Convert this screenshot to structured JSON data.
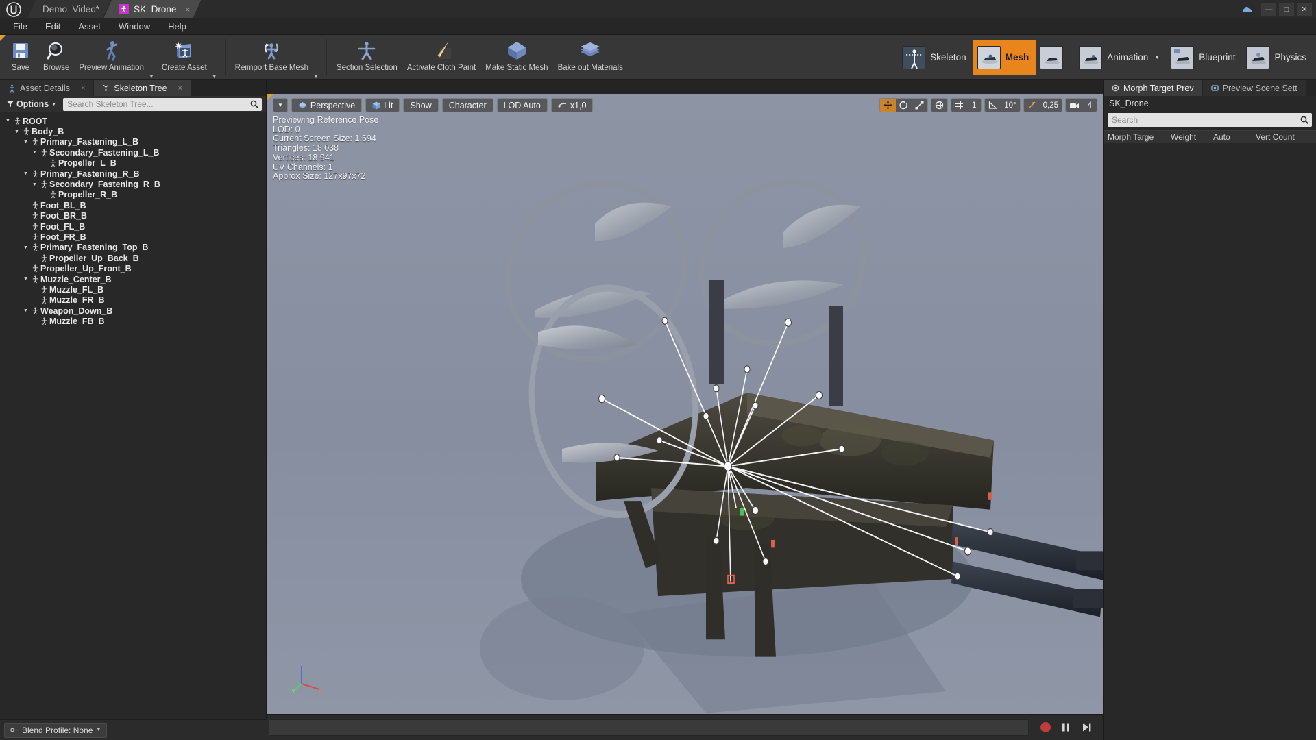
{
  "window": {
    "app": "Unreal Engine",
    "logo_glyph": "Ⓤ",
    "tabs": [
      {
        "label": "Demo_Video*",
        "icon": "",
        "active": false,
        "close": "×"
      },
      {
        "label": "SK_Drone",
        "icon": "person-icon",
        "active": true,
        "close": "×"
      }
    ],
    "controls": {
      "cloud": "☁",
      "minimize": "—",
      "maximize": "□",
      "close": "✕"
    }
  },
  "menubar": {
    "items": [
      "File",
      "Edit",
      "Asset",
      "Window",
      "Help"
    ]
  },
  "toolbar": {
    "groups": [
      {
        "buttons": [
          {
            "label": "Save",
            "icon": "save-icon",
            "caret": false
          },
          {
            "label": "Browse",
            "icon": "browse-icon",
            "caret": false
          },
          {
            "label": "Preview Animation",
            "icon": "preview-animation-icon",
            "caret": true
          },
          {
            "label": "Create Asset",
            "icon": "create-asset-icon",
            "caret": true
          }
        ]
      },
      {
        "buttons": [
          {
            "label": "Reimport Base Mesh",
            "icon": "reimport-icon",
            "caret": true
          }
        ]
      },
      {
        "buttons": [
          {
            "label": "Section Selection",
            "icon": "section-selection-icon",
            "caret": false
          },
          {
            "label": "Activate Cloth Paint",
            "icon": "cloth-paint-icon",
            "caret": false
          },
          {
            "label": "Make Static Mesh",
            "icon": "make-static-mesh-icon",
            "caret": false
          },
          {
            "label": "Bake out Materials",
            "icon": "bake-materials-icon",
            "caret": false
          }
        ]
      }
    ],
    "modes": [
      {
        "label": "Skeleton",
        "active": false,
        "caret": false,
        "icon": "skeleton-thumb"
      },
      {
        "label": "Mesh",
        "active": true,
        "caret": false,
        "icon": "mesh-thumb"
      },
      {
        "label": "",
        "active": false,
        "caret": false,
        "icon": "anim-thumb-small"
      },
      {
        "label": "Animation",
        "active": false,
        "caret": true,
        "icon": "animation-thumb"
      },
      {
        "label": "Blueprint",
        "active": false,
        "caret": false,
        "icon": "blueprint-thumb"
      },
      {
        "label": "Physics",
        "active": false,
        "caret": false,
        "icon": "physics-thumb"
      }
    ]
  },
  "left_panel": {
    "tabs": [
      {
        "label": "Asset Details",
        "active": false,
        "icon": "asset-details-icon",
        "close": "×"
      },
      {
        "label": "Skeleton Tree",
        "active": true,
        "icon": "skeleton-tree-icon",
        "close": "×"
      }
    ],
    "options_label": "Options",
    "search_placeholder": "Search Skeleton Tree...",
    "search_value": "",
    "tree": [
      {
        "label": "ROOT",
        "depth": 0,
        "expandable": true
      },
      {
        "label": "Body_B",
        "depth": 1,
        "expandable": true
      },
      {
        "label": "Primary_Fastening_L_B",
        "depth": 2,
        "expandable": true
      },
      {
        "label": "Secondary_Fastening_L_B",
        "depth": 3,
        "expandable": true
      },
      {
        "label": "Propeller_L_B",
        "depth": 4,
        "expandable": false
      },
      {
        "label": "Primary_Fastening_R_B",
        "depth": 2,
        "expandable": true
      },
      {
        "label": "Secondary_Fastening_R_B",
        "depth": 3,
        "expandable": true
      },
      {
        "label": "Propeller_R_B",
        "depth": 4,
        "expandable": false
      },
      {
        "label": "Foot_BL_B",
        "depth": 2,
        "expandable": false
      },
      {
        "label": "Foot_BR_B",
        "depth": 2,
        "expandable": false
      },
      {
        "label": "Foot_FL_B",
        "depth": 2,
        "expandable": false
      },
      {
        "label": "Foot_FR_B",
        "depth": 2,
        "expandable": false
      },
      {
        "label": "Primary_Fastening_Top_B",
        "depth": 2,
        "expandable": true
      },
      {
        "label": "Propeller_Up_Back_B",
        "depth": 3,
        "expandable": false
      },
      {
        "label": "Propeller_Up_Front_B",
        "depth": 2,
        "expandable": false
      },
      {
        "label": "Muzzle_Center_B",
        "depth": 2,
        "expandable": true
      },
      {
        "label": "Muzzle_FL_B",
        "depth": 3,
        "expandable": false
      },
      {
        "label": "Muzzle_FR_B",
        "depth": 3,
        "expandable": false
      },
      {
        "label": "Weapon_Down_B",
        "depth": 2,
        "expandable": true
      },
      {
        "label": "Muzzle_FB_B",
        "depth": 3,
        "expandable": false
      }
    ],
    "blend_profile_label": "Blend Profile: None"
  },
  "viewport": {
    "toolbar_left": [
      {
        "label": "",
        "icon": "chevron-down-icon",
        "type": "caret"
      },
      {
        "label": "Perspective",
        "icon": "perspective-icon",
        "type": "text"
      },
      {
        "label": "Lit",
        "icon": "lit-cube-icon",
        "type": "text"
      },
      {
        "label": "Show",
        "icon": "",
        "type": "text"
      },
      {
        "label": "Character",
        "icon": "",
        "type": "text"
      },
      {
        "label": "LOD Auto",
        "icon": "",
        "type": "text"
      },
      {
        "label": "x1,0",
        "icon": "playrate-icon",
        "type": "text"
      }
    ],
    "toolbar_right": [
      {
        "label": "",
        "icon": "move-icon",
        "selected": true
      },
      {
        "label": "",
        "icon": "rotate-icon",
        "selected": false
      },
      {
        "label": "",
        "icon": "scale-icon",
        "selected": false
      },
      {
        "label": "",
        "icon": "world-axis-icon",
        "selected": false
      },
      {
        "label": "",
        "icon": "grid-snap-icon",
        "selected": false
      },
      {
        "label": "1",
        "icon": "grid-size-value",
        "selected": false
      },
      {
        "label": "",
        "icon": "angle-snap-icon",
        "selected": false
      },
      {
        "label": "10°",
        "icon": "angle-value",
        "selected": false
      },
      {
        "label": "",
        "icon": "scale-snap-icon",
        "selected": false
      },
      {
        "label": "0,25",
        "icon": "scale-value",
        "selected": false
      },
      {
        "label": "",
        "icon": "camera-speed-icon",
        "selected": false
      },
      {
        "label": "4",
        "icon": "camera-speed-value",
        "selected": false
      }
    ],
    "stats": [
      "Previewing Reference Pose",
      "LOD: 0",
      "Current Screen Size: 1,694",
      "Triangles: 18 038",
      "Vertices: 18 941",
      "UV Channels: 1",
      "Approx Size: 127x97x72"
    ],
    "axis": {
      "x": "x",
      "y": "y",
      "z": "z"
    },
    "transport": {
      "record": "record-button",
      "pause": "pause-button",
      "step": "step-button"
    }
  },
  "right_panel": {
    "tabs": [
      {
        "label": "Morph Target Prev",
        "active": true,
        "icon": "morph-target-icon",
        "close": ""
      },
      {
        "label": "Preview Scene Sett",
        "active": false,
        "icon": "preview-scene-icon",
        "close": ""
      }
    ],
    "asset_name": "SK_Drone",
    "search_placeholder": "Search",
    "search_value": "",
    "columns": [
      "Morph Targe",
      "Weight",
      "Auto",
      "Vert Count"
    ],
    "rows": []
  },
  "colors": {
    "accent_orange": "#e8861d",
    "panel_bg": "#282828",
    "toolbar_bg": "#373737",
    "viewport_bg": "#8b93a3",
    "record_red": "#c23b3b"
  }
}
